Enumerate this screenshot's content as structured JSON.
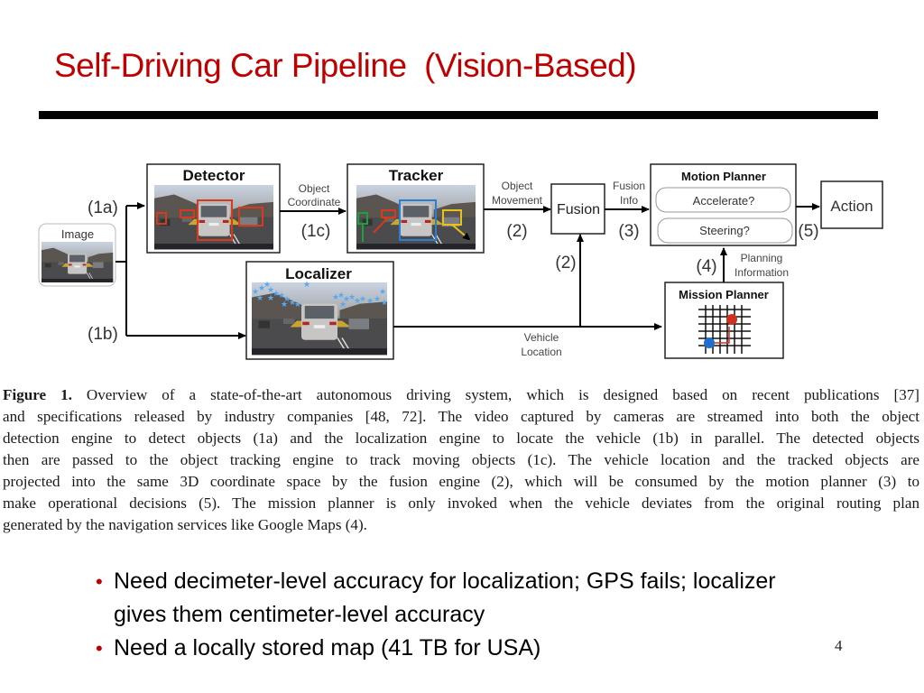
{
  "slide": {
    "title": "Self-Driving Car Pipeline  (Vision-Based)",
    "page_number": "4"
  },
  "diagram": {
    "image_label": "Image",
    "detector_title": "Detector",
    "tracker_title": "Tracker",
    "localizer_title": "Localizer",
    "fusion_label": "Fusion",
    "motion_planner_title": "Motion Planner",
    "accelerate_label": "Accelerate?",
    "steering_label": "Steering?",
    "action_label": "Action",
    "mission_planner_title": "Mission Planner",
    "edge_1a": "(1a)",
    "edge_1b": "(1b)",
    "edge_1c": "(1c)",
    "edge_2_top": "(2)",
    "edge_2_side": "(2)",
    "edge_3": "(3)",
    "edge_4": "(4)",
    "edge_5": "(5)",
    "object_coordinate_line1": "Object",
    "object_coordinate_line2": "Coordinate",
    "object_movement_line1": "Object",
    "object_movement_line2": "Movement",
    "fusion_info_line1": "Fusion",
    "fusion_info_line2": "Info",
    "planning_info_line1": "Planning",
    "planning_info_line2": "Information",
    "vehicle_location_line1": "Vehicle",
    "vehicle_location_line2": "Location",
    "colors": {
      "detector_box": "#d93a1c",
      "tracker_green": "#1aa33a",
      "tracker_red": "#d93a1c",
      "tracker_blue": "#2a7fd4",
      "tracker_yellow": "#e8c21a",
      "localizer_star": "#5aa8ee",
      "mission_start": "#1f6fd0",
      "mission_goal": "#d0311e"
    }
  },
  "caption": {
    "label": "Figure 1.",
    "lines": [
      " Overview of a state-of-the-art autonomous driving system, which is designed based on recent publications [37]",
      "and specifications released by industry companies [48, 72]. The video captured by cameras are streamed into both the object",
      "detection engine to detect objects (1a) and the localization engine to locate the vehicle (1b) in parallel. The detected objects",
      "then are passed to the object tracking engine to track moving objects (1c). The vehicle location and the tracked objects are",
      "projected into the same 3D coordinate space by the fusion engine (2), which will be consumed by the motion planner (3) to",
      "make operational decisions (5). The mission planner is only invoked when the vehicle deviates from the original routing plan",
      "generated by the navigation services like Google Maps (4)."
    ]
  },
  "bullets": [
    {
      "line1": "Need decimeter-level accuracy for localization; GPS fails; localizer",
      "line2": "gives them centimeter-level accuracy"
    },
    {
      "line1": "Need a locally stored map (41 TB for USA)",
      "line2": ""
    }
  ],
  "bullet_color": "#c00000",
  "title_color": "#c00000"
}
